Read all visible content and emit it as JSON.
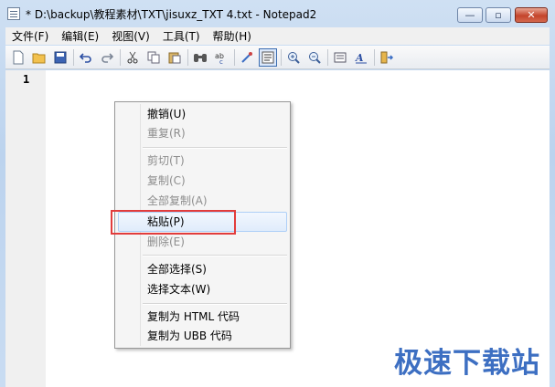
{
  "window": {
    "title": "* D:\\backup\\教程素材\\TXT\\jisuxz_TXT 4.txt - Notepad2",
    "min_glyph": "—",
    "max_glyph": "▫",
    "close_glyph": "✕"
  },
  "menubar": {
    "items": [
      "文件(F)",
      "编辑(E)",
      "视图(V)",
      "工具(T)",
      "帮助(H)"
    ]
  },
  "toolbar": {
    "icons": [
      "new-file-icon",
      "open-folder-icon",
      "save-icon",
      "undo-icon",
      "redo-icon",
      "cut-icon",
      "copy-icon",
      "paste-icon",
      "find-icon",
      "replace-icon",
      "word-wrap-icon",
      "view-whitespace-icon",
      "zoom-in-icon",
      "zoom-out-icon",
      "scheme-icon",
      "font-icon",
      "exit-icon"
    ]
  },
  "editor": {
    "line_number": "1"
  },
  "context_menu": {
    "undo": "撤销(U)",
    "redo": "重复(R)",
    "cut": "剪切(T)",
    "copy": "复制(C)",
    "copy_all": "全部复制(A)",
    "paste": "粘贴(P)",
    "delete": "删除(E)",
    "select_all": "全部选择(S)",
    "select_text": "选择文本(W)",
    "copy_html": "复制为 HTML 代码",
    "copy_ubb": "复制为 UBB 代码"
  },
  "watermark": "极速下载站",
  "colors": {
    "highlight": "#e23c3c",
    "watermark": "#3d6fc2"
  }
}
